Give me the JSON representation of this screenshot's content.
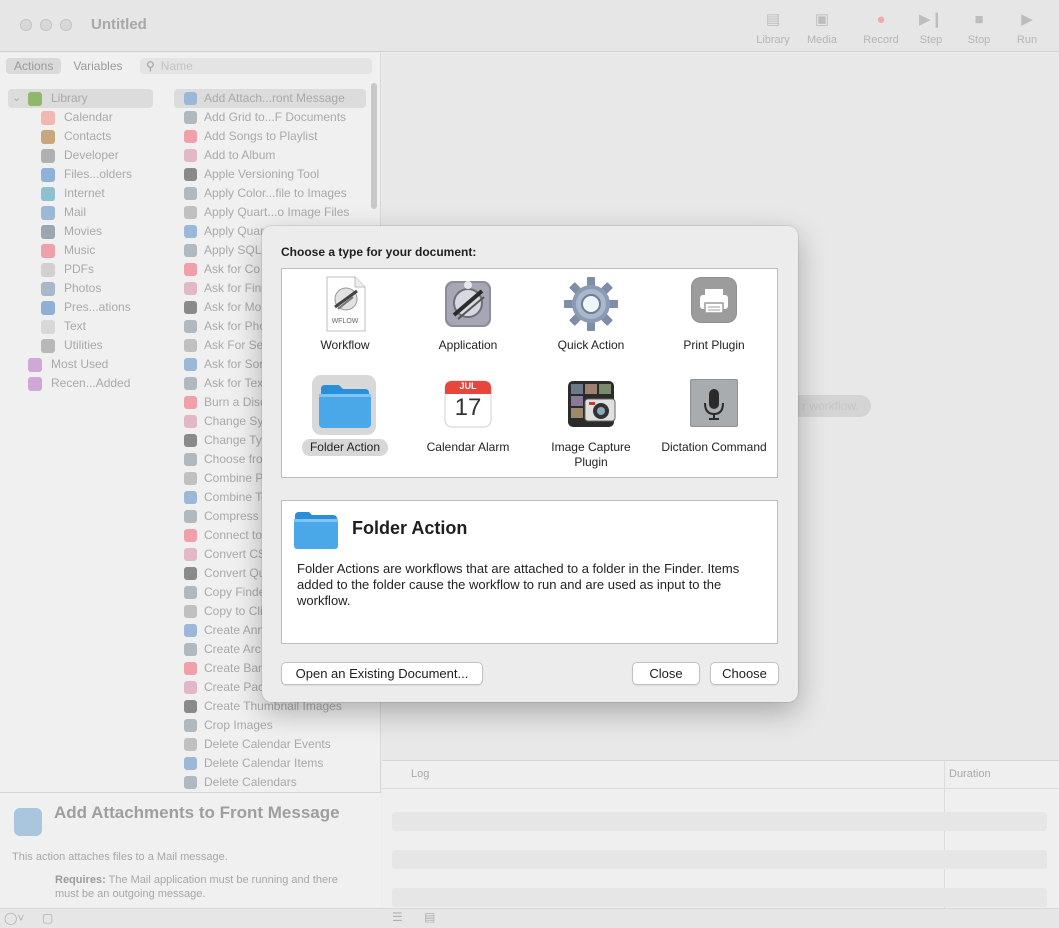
{
  "window": {
    "title": "Untitled",
    "toolbar": [
      {
        "label": "Library",
        "icon": "library-icon"
      },
      {
        "label": "Media",
        "icon": "media-icon"
      },
      {
        "label": "Record",
        "icon": "record-icon"
      },
      {
        "label": "Step",
        "icon": "step-icon"
      },
      {
        "label": "Stop",
        "icon": "stop-icon"
      },
      {
        "label": "Run",
        "icon": "run-icon"
      }
    ]
  },
  "sidebar": {
    "tabs": [
      "Actions",
      "Variables"
    ],
    "search_placeholder": "Name",
    "library": [
      {
        "label": "Library",
        "color": "#8fb86a"
      },
      {
        "label": "Calendar",
        "color": "#f0b8b0"
      },
      {
        "label": "Contacts",
        "color": "#c9a77e"
      },
      {
        "label": "Developer",
        "color": "#b0b0b0"
      },
      {
        "label": "Files...olders",
        "color": "#8fb2d8"
      },
      {
        "label": "Internet",
        "color": "#8fc0d0"
      },
      {
        "label": "Mail",
        "color": "#9bb8d8"
      },
      {
        "label": "Movies",
        "color": "#9aa7b0"
      },
      {
        "label": "Music",
        "color": "#f0a0a8"
      },
      {
        "label": "PDFs",
        "color": "#d0d0d0"
      },
      {
        "label": "Photos",
        "color": "#a9b8c8"
      },
      {
        "label": "Pres...ations",
        "color": "#90b0d8"
      },
      {
        "label": "Text",
        "color": "#d8d8d8"
      },
      {
        "label": "Utilities",
        "color": "#b8b8b8"
      },
      {
        "label": "Most Used",
        "color": "#d0a8d8"
      },
      {
        "label": "Recen...Added",
        "color": "#d0a8d8"
      }
    ],
    "actions": [
      "Add Attach...ront Message",
      "Add Grid to...F Documents",
      "Add Songs to Playlist",
      "Add to Album",
      "Apple Versioning Tool",
      "Apply Color...file to Images",
      "Apply Quart...o Image Files",
      "Apply Quar",
      "Apply SQL",
      "Ask for Co",
      "Ask for Find",
      "Ask for Mo",
      "Ask for Pho",
      "Ask For Se",
      "Ask for Sor",
      "Ask for Tex",
      "Burn a Disc",
      "Change Sy",
      "Change Typ",
      "Choose fro",
      "Combine P",
      "Combine Te",
      "Compress",
      "Connect to",
      "Convert CS",
      "Convert Qu",
      "Copy Finde",
      "Copy to Cli",
      "Create Ann",
      "Create Arc",
      "Create Ban",
      "Create Pac",
      "Create Thumbnail Images",
      "Crop Images",
      "Delete Calendar Events",
      "Delete Calendar Items",
      "Delete Calendars"
    ],
    "description": {
      "title": "Add Attachments to Front Message",
      "summary": "This action attaches files to a Mail message.",
      "requires_label": "Requires:",
      "requires_text": "The Mail application must be running and there must be an outgoing message."
    }
  },
  "workflow": {
    "hint": "r workflow.",
    "log_header": "Log",
    "duration_header": "Duration"
  },
  "dialog": {
    "prompt": "Choose a type for your document:",
    "types": [
      {
        "label": "Workflow",
        "icon": "workflow-icon",
        "icon_text": "WFLOW"
      },
      {
        "label": "Application",
        "icon": "application-icon"
      },
      {
        "label": "Quick Action",
        "icon": "gear-icon"
      },
      {
        "label": "Print Plugin",
        "icon": "printer-icon"
      },
      {
        "label": "Folder Action",
        "icon": "folder-icon",
        "selected": true
      },
      {
        "label": "Calendar Alarm",
        "icon": "calendar-icon",
        "month": "JUL",
        "day": "17"
      },
      {
        "label": "Image Capture Plugin",
        "icon": "camera-icon"
      },
      {
        "label": "Dictation Command",
        "icon": "microphone-icon"
      }
    ],
    "selected_title": "Folder Action",
    "selected_description": "Folder Actions are workflows that are attached to a folder in the Finder. Items added to the folder cause the workflow to run and are used as input to the workflow.",
    "buttons": {
      "open_existing": "Open an Existing Document...",
      "close": "Close",
      "choose": "Choose"
    },
    "colors": {
      "folder_blue": "#4aa8e8",
      "calendar_red": "#e8453c"
    }
  }
}
